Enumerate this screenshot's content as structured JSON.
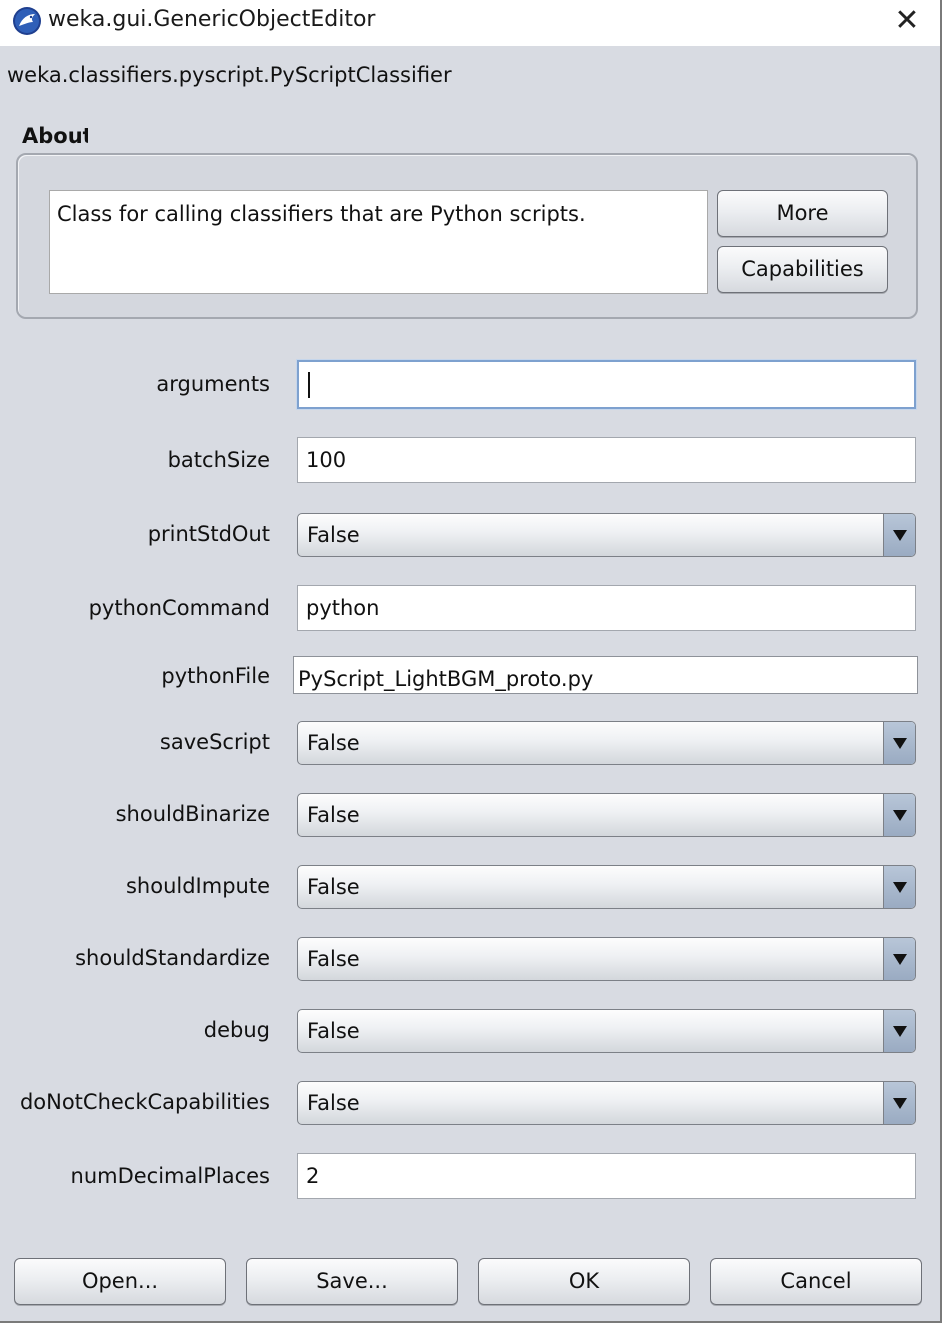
{
  "window": {
    "title": "weka.gui.GenericObjectEditor",
    "close_glyph": "✕"
  },
  "classname": "weka.classifiers.pyscript.PyScriptClassifier",
  "about": {
    "label": "About",
    "text": "Class for calling classifiers that are Python scripts.",
    "more_label": "More",
    "capabilities_label": "Capabilities"
  },
  "properties": {
    "arguments": {
      "label": "arguments",
      "value": ""
    },
    "batchSize": {
      "label": "batchSize",
      "value": "100"
    },
    "printStdOut": {
      "label": "printStdOut",
      "value": "False"
    },
    "pythonCommand": {
      "label": "pythonCommand",
      "value": "python"
    },
    "pythonFile": {
      "label": "pythonFile",
      "value": "PyScript_LightBGM_proto.py"
    },
    "saveScript": {
      "label": "saveScript",
      "value": "False"
    },
    "shouldBinarize": {
      "label": "shouldBinarize",
      "value": "False"
    },
    "shouldImpute": {
      "label": "shouldImpute",
      "value": "False"
    },
    "shouldStandardize": {
      "label": "shouldStandardize",
      "value": "False"
    },
    "debug": {
      "label": "debug",
      "value": "False"
    },
    "doNotCheckCapabilities": {
      "label": "doNotCheckCapabilities",
      "value": "False"
    },
    "numDecimalPlaces": {
      "label": "numDecimalPlaces",
      "value": "2"
    }
  },
  "buttons": {
    "open": "Open...",
    "save": "Save...",
    "ok": "OK",
    "cancel": "Cancel"
  },
  "icons": {
    "title": "weka-bird-icon",
    "dropdown": "chevron-down-icon"
  },
  "colors": {
    "window_bg": "#d8dbe2",
    "focus_border": "#7ea1cf",
    "combo_arrow": "#9aabc2"
  }
}
